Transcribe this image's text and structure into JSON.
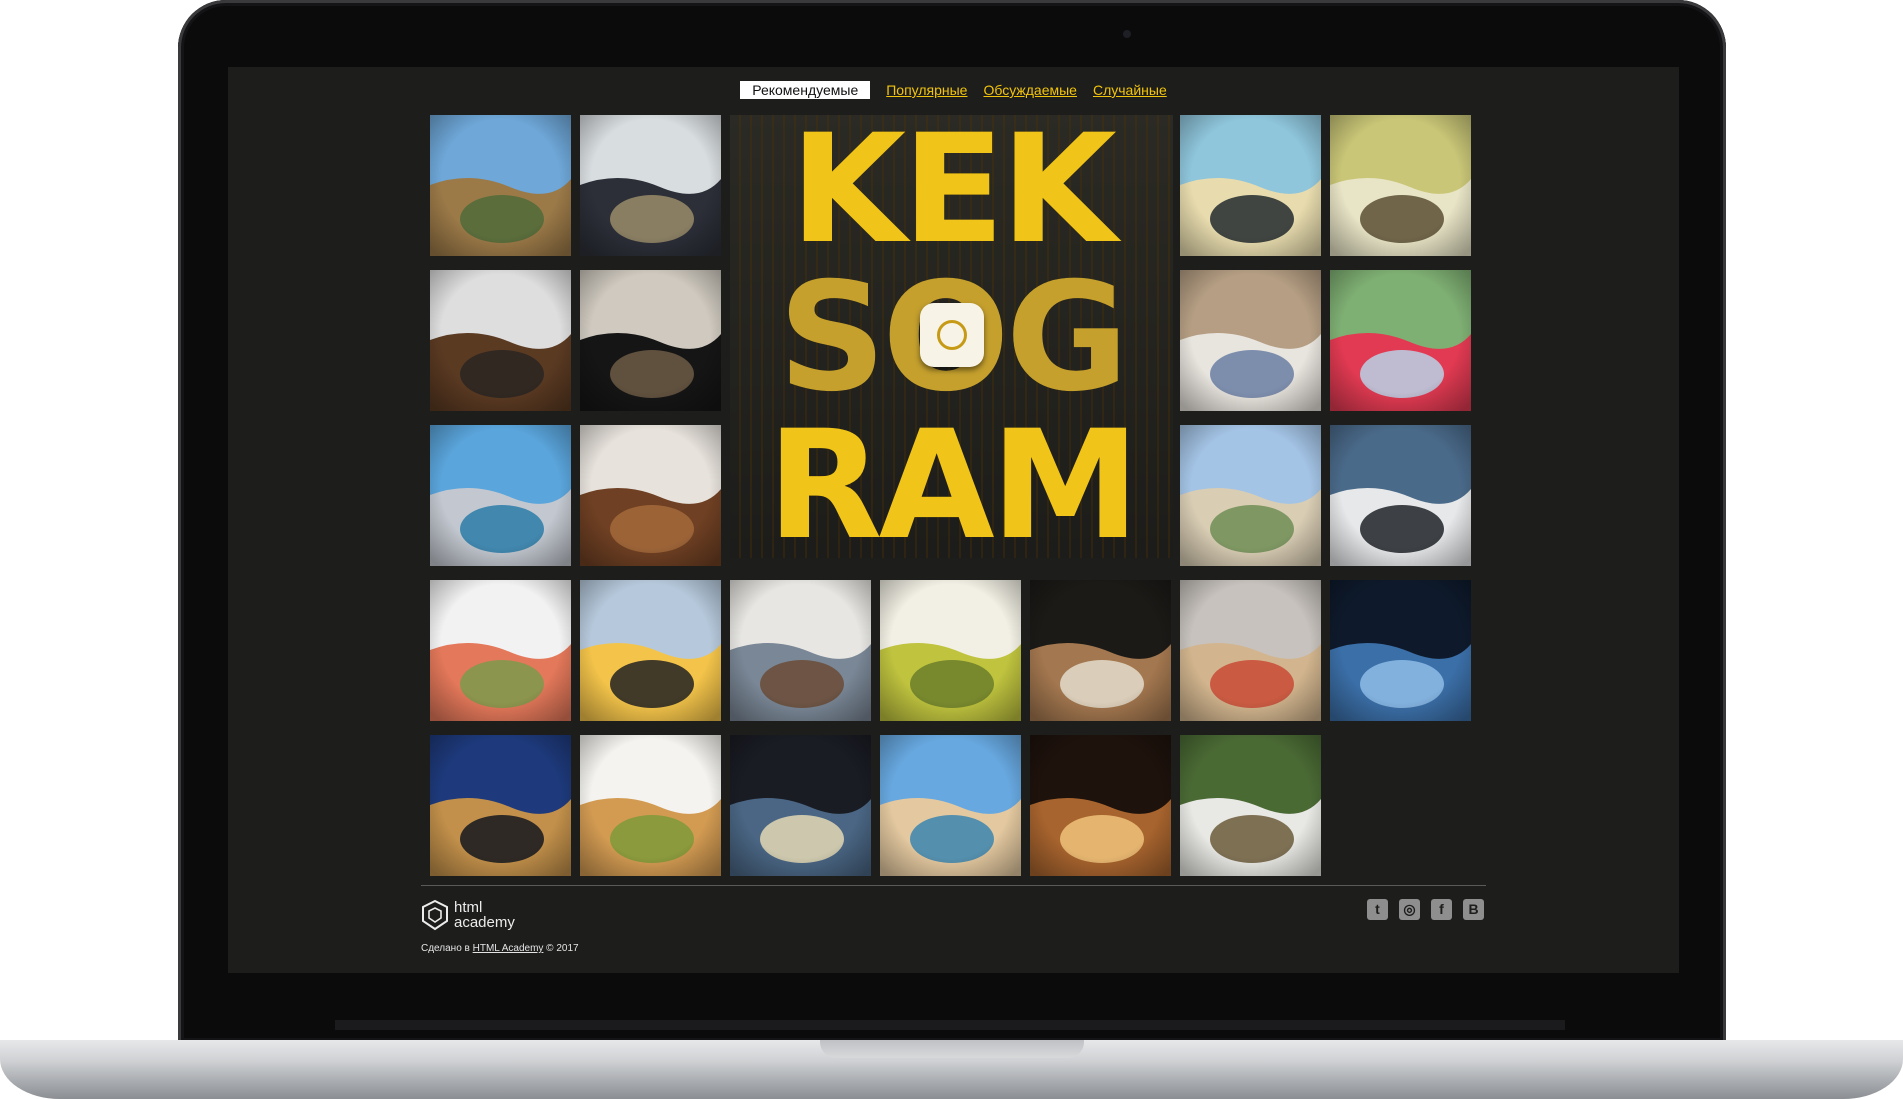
{
  "filters": [
    {
      "label": "Рекомендуемые",
      "active": true
    },
    {
      "label": "Популярные",
      "active": false
    },
    {
      "label": "Обсуждаемые",
      "active": false
    },
    {
      "label": "Случайные",
      "active": false
    }
  ],
  "logo": {
    "lines": [
      "KEK",
      "SOG",
      "RAM"
    ],
    "badge_icon": "camera-lens-icon"
  },
  "pictures": [
    {
      "name": "photo-coast-resort",
      "colors": [
        "#6ea7d8",
        "#9c7a48",
        "#4f6b3a"
      ]
    },
    {
      "name": "photo-car-excavator",
      "colors": [
        "#d8dde0",
        "#2c2f38",
        "#9a8c6a"
      ]
    },
    {
      "name": "photo-beach-rocks",
      "colors": [
        "#8fc6dc",
        "#e8dcae",
        "#222a2e"
      ]
    },
    {
      "name": "photo-girl-camera",
      "colors": [
        "#c9c677",
        "#e8e4c6",
        "#5b4f32"
      ]
    },
    {
      "name": "photo-snowman-soup",
      "colors": [
        "#dedede",
        "#5b3a22",
        "#2a2622"
      ]
    },
    {
      "name": "photo-supercar",
      "colors": [
        "#cfc9bf",
        "#151515",
        "#6d5b45"
      ]
    },
    {
      "name": "photo-strawberry-plate",
      "colors": [
        "#b59e83",
        "#e8e4de",
        "#6a7fa4"
      ]
    },
    {
      "name": "photo-red-drink",
      "colors": [
        "#7fb073",
        "#e23a52",
        "#b8d4e8"
      ]
    },
    {
      "name": "photo-plane-beach",
      "colors": [
        "#5aa5dc",
        "#c3c8d0",
        "#2a7ba8"
      ]
    },
    {
      "name": "photo-shoe-rack",
      "colors": [
        "#e7e2dc",
        "#6f4023",
        "#a56a3b"
      ]
    },
    {
      "name": "photo-dunes-path",
      "colors": [
        "#a4c4e6",
        "#d9cdb4",
        "#6f8e55"
      ]
    },
    {
      "name": "photo-white-audi",
      "colors": [
        "#4a6a8a",
        "#e6e8ea",
        "#1e2227"
      ]
    },
    {
      "name": "photo-salmon-dish",
      "colors": [
        "#f2f2f2",
        "#e4785a",
        "#7d9a4b"
      ]
    },
    {
      "name": "photo-sushi-cat",
      "colors": [
        "#b6c9dc",
        "#f4c44a",
        "#222222"
      ]
    },
    {
      "name": "photo-slippers-sofa",
      "colors": [
        "#e7e6e2",
        "#7a8796",
        "#6b4b36"
      ]
    },
    {
      "name": "photo-safari-room",
      "colors": [
        "#f2f0e4",
        "#bfc33e",
        "#6a7e2a"
      ]
    },
    {
      "name": "photo-choir-stage",
      "colors": [
        "#1c1a17",
        "#a3774f",
        "#e4dccb"
      ]
    },
    {
      "name": "photo-pug-shoes",
      "colors": [
        "#c7c2bd",
        "#d2b58e",
        "#c94a35"
      ]
    },
    {
      "name": "photo-blue-light-feet",
      "colors": [
        "#0e1a2c",
        "#3b6fa8",
        "#8fbde8"
      ]
    },
    {
      "name": "photo-palm-night",
      "colors": [
        "#1e3a7c",
        "#c2904a",
        "#14181e"
      ]
    },
    {
      "name": "photo-pasta-bowl",
      "colors": [
        "#f4f3ef",
        "#d39b52",
        "#7c9a38"
      ]
    },
    {
      "name": "photo-concert-crowd",
      "colors": [
        "#1a1c24",
        "#4a6684",
        "#e4d9b4"
      ]
    },
    {
      "name": "photo-beach-woman",
      "colors": [
        "#67a8e0",
        "#e4c9a0",
        "#3b86b0"
      ]
    },
    {
      "name": "photo-concert-hands",
      "colors": [
        "#1e120c",
        "#a8642e",
        "#f0c37a"
      ]
    },
    {
      "name": "photo-jeep-river",
      "colors": [
        "#4a6a34",
        "#e8e8e4",
        "#6b5a3a"
      ]
    }
  ],
  "footer": {
    "logo_line1": "html",
    "logo_line2": "academy",
    "copyright_prefix": "Сделано в ",
    "copyright_link": "HTML Academy",
    "copyright_suffix": " © 2017",
    "socials": [
      {
        "name": "twitter-icon",
        "glyph": "t"
      },
      {
        "name": "instagram-icon",
        "glyph": "◎"
      },
      {
        "name": "facebook-icon",
        "glyph": "f"
      },
      {
        "name": "vk-icon",
        "glyph": "B"
      }
    ]
  },
  "colors": {
    "accent": "#f2c40c",
    "screen_bg": "#1d1d1c",
    "frame": "#0b0b0c"
  }
}
